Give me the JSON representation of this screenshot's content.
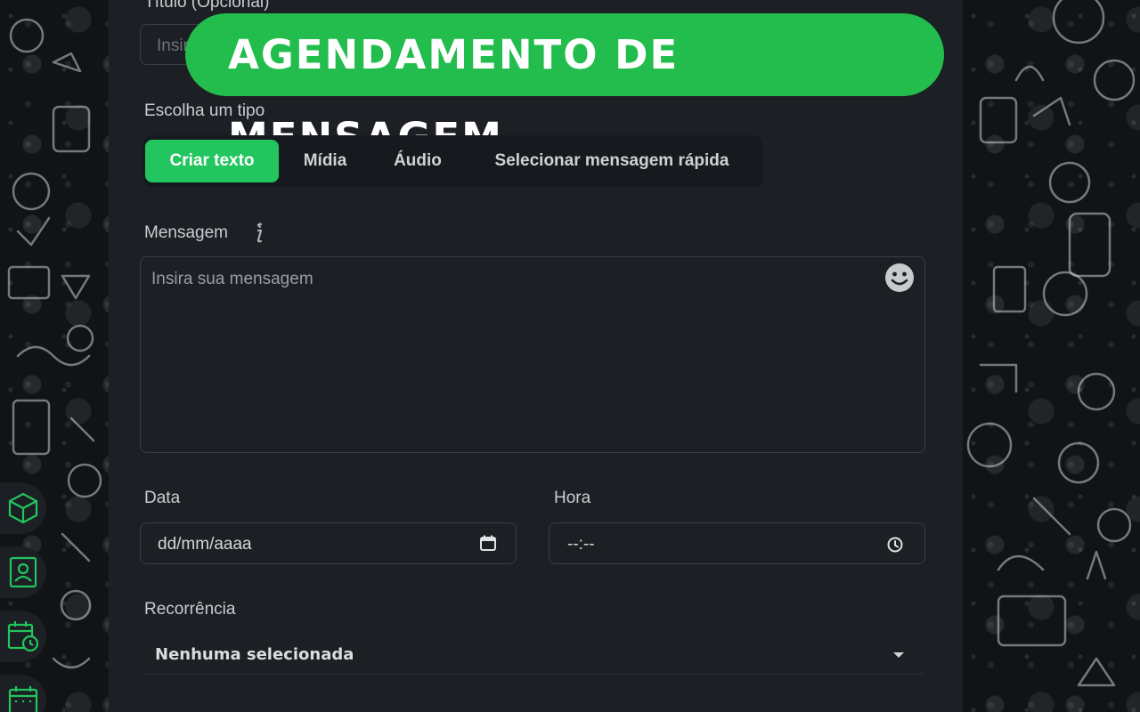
{
  "banner": {
    "title": "AGENDAMENTO DE MENSAGEM"
  },
  "form": {
    "title_field": {
      "label": "Título (Opcional)",
      "placeholder": "Insira"
    },
    "type_section": {
      "label": "Escolha um tipo",
      "options": [
        "Criar texto",
        "Mídia",
        "Áudio",
        "Selecionar mensagem rápida"
      ],
      "selected": "Criar texto"
    },
    "message": {
      "label": "Mensagem",
      "label_icon": "info-icon",
      "placeholder": "Insira sua mensagem",
      "emoji_icon": "emoji-icon"
    },
    "date": {
      "label": "Data",
      "value": "dd/mm/aaaa",
      "icon": "calendar-icon"
    },
    "time": {
      "label": "Hora",
      "value": "--:--",
      "icon": "clock-icon"
    },
    "recurrence": {
      "label": "Recorrência",
      "value": "Nenhuma selecionada",
      "icon": "caret-down-icon"
    }
  },
  "sidebar": {
    "items": [
      {
        "icon": "cube-icon"
      },
      {
        "icon": "contact-card-icon"
      },
      {
        "icon": "calendar-clock-icon"
      },
      {
        "icon": "calendar-grid-icon"
      }
    ]
  },
  "colors": {
    "accent": "#22c55e",
    "banner": "#22bd4c",
    "panel": "#1c1f24",
    "background": "#111315"
  }
}
